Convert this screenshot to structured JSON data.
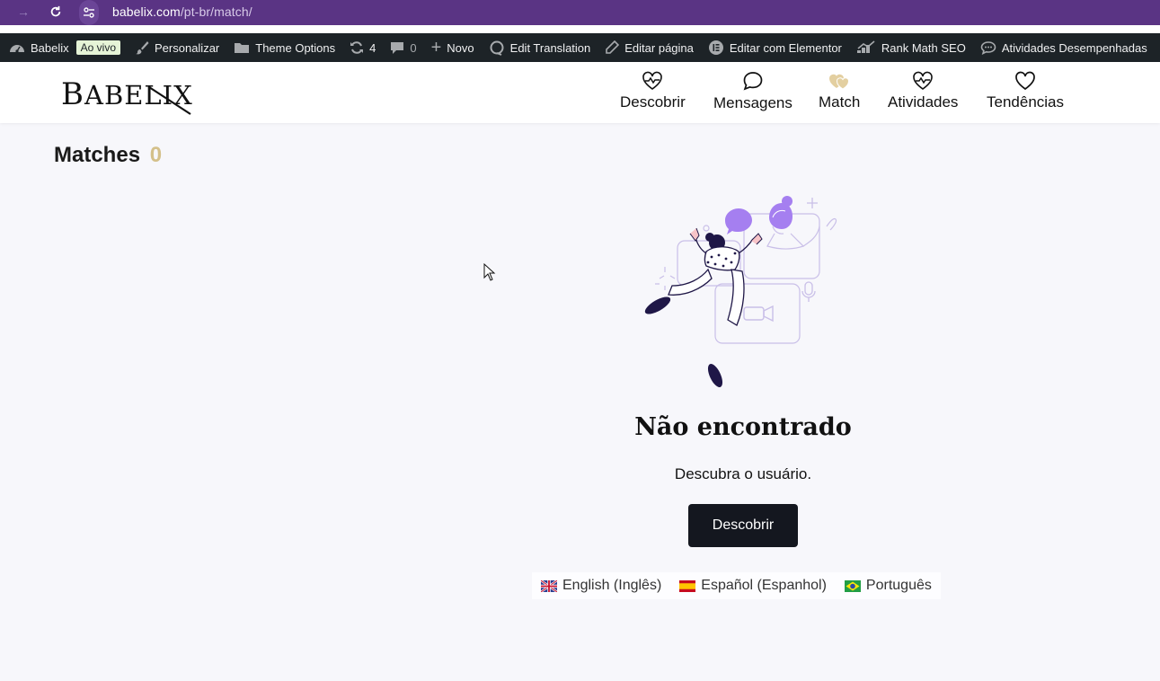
{
  "browser": {
    "url_domain": "babelix.com",
    "url_path": "/pt-br/match/"
  },
  "adminbar": {
    "site_name": "Babelix",
    "live_badge": "Ao vivo",
    "customize": "Personalizar",
    "theme_options": "Theme Options",
    "updates_count": "4",
    "comments_count": "0",
    "new": "Novo",
    "edit_translation": "Edit Translation",
    "edit_page": "Editar página",
    "edit_elementor": "Editar com Elementor",
    "rank_math": "Rank Math SEO",
    "activities": "Atividades Desempenhadas"
  },
  "header": {
    "logo_first": "B",
    "logo_rest": "ABELIX",
    "nav": [
      {
        "label": "Descobrir",
        "icon": "heartbeat-icon"
      },
      {
        "label": "Mensagens",
        "icon": "chat-bubble-icon"
      },
      {
        "label": "Match",
        "icon": "double-heart-icon"
      },
      {
        "label": "Atividades",
        "icon": "heartbeat-icon"
      },
      {
        "label": "Tendências",
        "icon": "heart-icon"
      }
    ]
  },
  "main": {
    "title": "Matches",
    "count": "0",
    "empty_title": "Não encontrado",
    "empty_subtitle": "Descubra o usuário.",
    "cta_label": "Descobrir"
  },
  "languages": [
    {
      "label": "English (Inglês)",
      "flag": "uk-flag-icon"
    },
    {
      "label": "Español (Espanhol)",
      "flag": "spain-flag-icon"
    },
    {
      "label": "Português",
      "flag": "brazil-flag-icon"
    }
  ],
  "colors": {
    "browser_bar": "#5a3484",
    "admin_bar": "#1d2327",
    "accent_count": "#d4c08a",
    "match_active": "#e3cfa0",
    "cta_bg": "#14171f",
    "illustration_purple": "#a57ff0"
  }
}
